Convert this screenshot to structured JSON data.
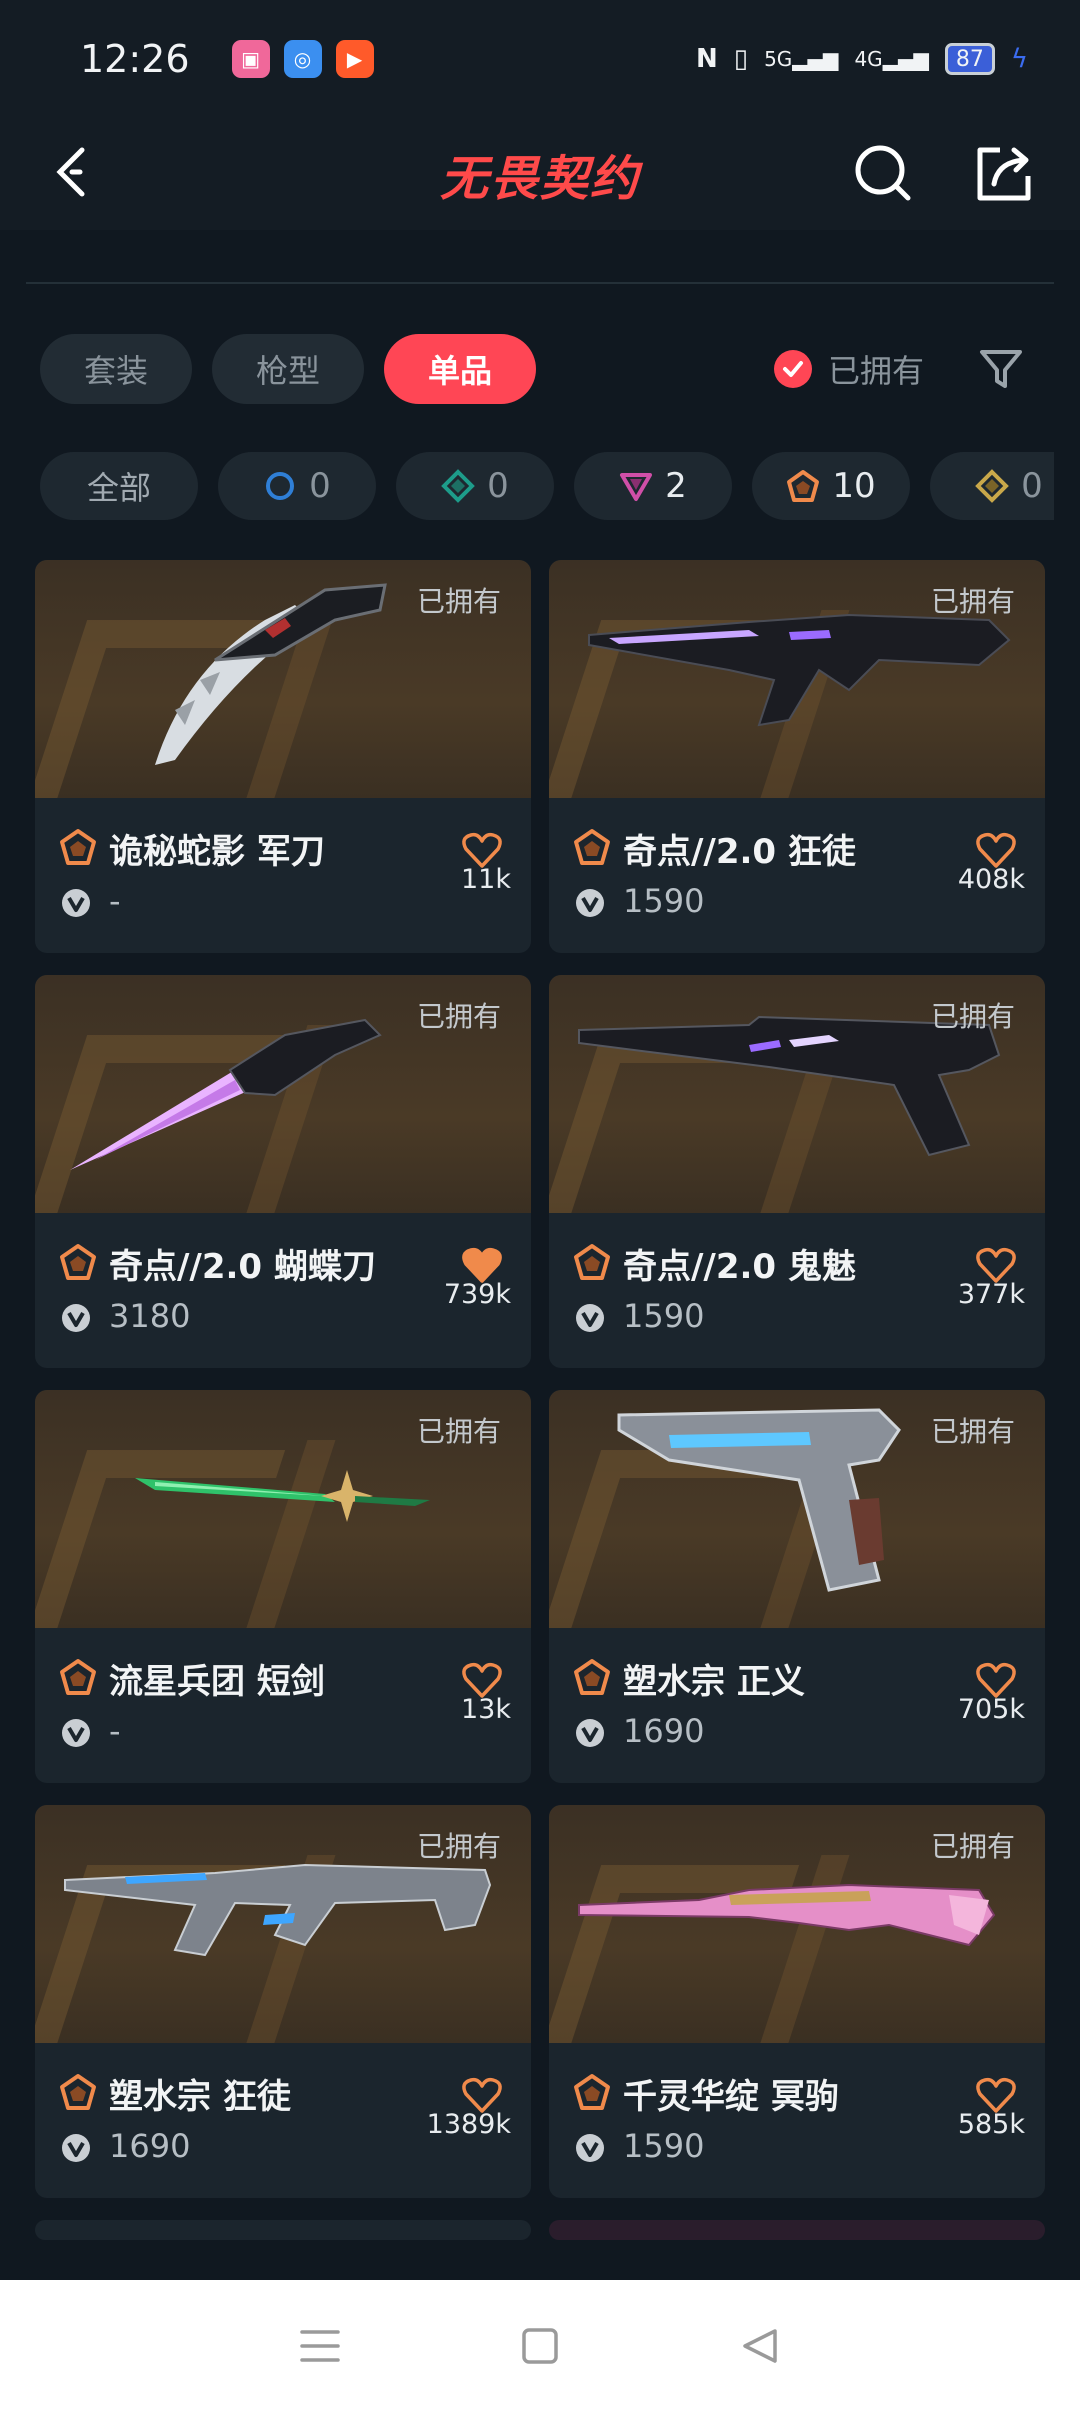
{
  "status": {
    "time": "12:26",
    "network_5g": "5G",
    "network_4g": "4G",
    "battery": "87"
  },
  "header": {
    "title": "无畏契约"
  },
  "tabs": [
    {
      "label": "套装",
      "active": false
    },
    {
      "label": "枪型",
      "active": false
    },
    {
      "label": "单品",
      "active": true
    }
  ],
  "owned_filter": {
    "label": "已拥有",
    "checked": true
  },
  "tier_chips": [
    {
      "label": "全部",
      "count": ""
    },
    {
      "icon": "select-tier-icon",
      "color": "#2f7fd6",
      "count": "0"
    },
    {
      "icon": "deluxe-tier-icon",
      "color": "#1d9c8a",
      "count": "0"
    },
    {
      "icon": "premium-tier-icon",
      "color": "#d04fa8",
      "count": "2"
    },
    {
      "icon": "exclusive-tier-icon",
      "color": "#f08a4b",
      "count": "10"
    },
    {
      "icon": "ultra-tier-icon",
      "color": "#c9a84a",
      "count": "0"
    }
  ],
  "items": [
    {
      "owned_label": "已拥有",
      "name": "诡秘蛇影 军刀",
      "price": "-",
      "likes": "11k",
      "favorited": false,
      "weapon": "knife-curved"
    },
    {
      "owned_label": "已拥有",
      "name": "奇点//2.0 狂徒",
      "price": "1590",
      "likes": "408k",
      "favorited": false,
      "weapon": "rifle-dark"
    },
    {
      "owned_label": "已拥有",
      "name": "奇点//2.0 蝴蝶刀",
      "price": "3180",
      "likes": "739k",
      "favorited": true,
      "weapon": "knife-crystal"
    },
    {
      "owned_label": "已拥有",
      "name": "奇点//2.0 鬼魅",
      "price": "1590",
      "likes": "377k",
      "favorited": false,
      "weapon": "pistol-dark"
    },
    {
      "owned_label": "已拥有",
      "name": "流星兵团 短剑",
      "price": "-",
      "likes": "13k",
      "favorited": false,
      "weapon": "sword-green"
    },
    {
      "owned_label": "已拥有",
      "name": "塑水宗 正义",
      "price": "1690",
      "likes": "705k",
      "favorited": false,
      "weapon": "pistol-silver"
    },
    {
      "owned_label": "已拥有",
      "name": "塑水宗 狂徒",
      "price": "1690",
      "likes": "1389k",
      "favorited": false,
      "weapon": "rifle-silver"
    },
    {
      "owned_label": "已拥有",
      "name": "千灵华绽 冥驹",
      "price": "1590",
      "likes": "585k",
      "favorited": false,
      "weapon": "sniper-pink"
    }
  ],
  "colors": {
    "accent": "#ff4655",
    "heart": "#f08a4b",
    "tier_exclusive": "#f08a4b"
  }
}
